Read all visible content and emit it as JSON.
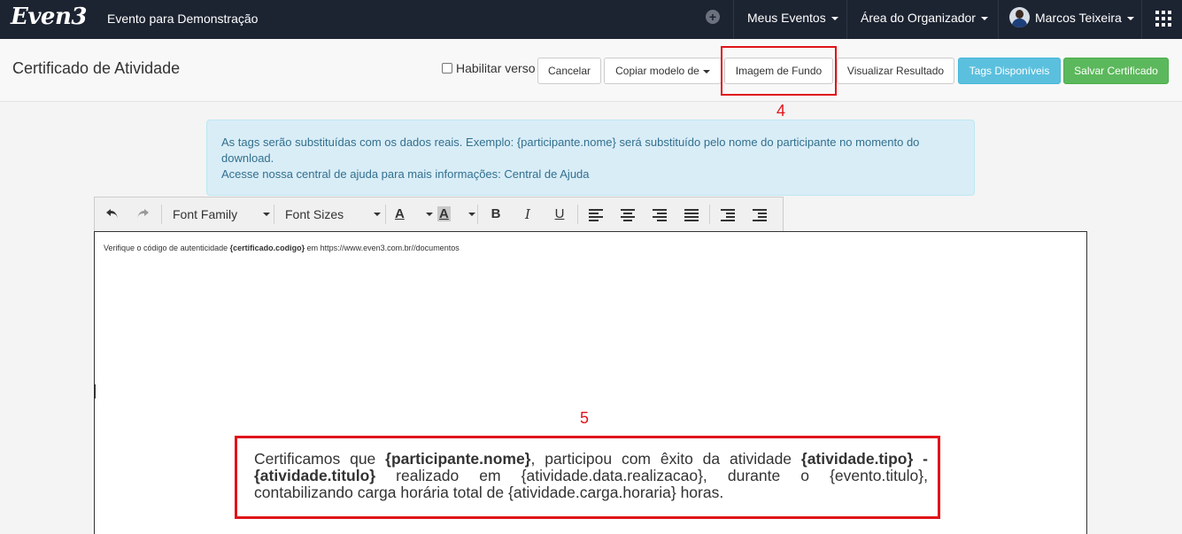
{
  "navbar": {
    "logo": "Even3",
    "event_name": "Evento para Demonstração",
    "meus_eventos": "Meus Eventos",
    "area_organizador": "Área do Organizador",
    "user_name": "Marcos Teixeira"
  },
  "header": {
    "title": "Certificado de Atividade",
    "habilitar_verso": "Habilitar verso",
    "cancel": "Cancelar",
    "copy_model": "Copiar modelo de",
    "background_image": "Imagem de Fundo",
    "view_result": "Visualizar Resultado",
    "tags": "Tags Disponíveis",
    "save": "Salvar Certificado"
  },
  "annotations": {
    "num4": "4",
    "num5": "5"
  },
  "alert": {
    "line1": "As tags serão substituídas com os dados reais. Exemplo: {participante.nome} será substituído pelo nome do participante no momento do download.",
    "line2_prefix": "Acesse nossa central de ajuda para mais informações: ",
    "help_link": "Central de Ajuda"
  },
  "toolbar": {
    "font_family": "Font Family",
    "font_sizes": "Font Sizes",
    "text_color_letter": "A",
    "highlight_letter": "A",
    "bold": "B",
    "italic": "I",
    "underline": "U"
  },
  "editor": {
    "auth_prefix": "Verifique o código de autenticidade ",
    "auth_tag": "{certificado.codigo}",
    "auth_suffix": " em https://www.even3.com.br//documentos",
    "cert_p1": "Certificamos que ",
    "cert_tag_nome": "{participante.nome}",
    "cert_p2": ", participou com êxito da atividade ",
    "cert_tag_tipo": "{atividade.tipo} - {atividade.titulo}",
    "cert_p3": " realizado em {atividade.data.realizacao}, durante o {evento.titulo}, contabilizando carga horária total de {atividade.carga.horaria} horas."
  },
  "colors": {
    "navbar_bg": "#1c2331",
    "info": "#5bc0de",
    "success": "#5cb85c",
    "callout": "#e0141a",
    "alert_bg": "#d9edf7"
  },
  "icons": [
    "plus-circle-icon",
    "chevron-down-icon",
    "avatar",
    "apps-grid-icon",
    "undo-icon",
    "redo-icon",
    "bold-icon",
    "italic-icon",
    "underline-icon",
    "align-left-icon",
    "align-center-icon",
    "align-right-icon",
    "justify-icon",
    "outdent-icon",
    "indent-icon"
  ]
}
